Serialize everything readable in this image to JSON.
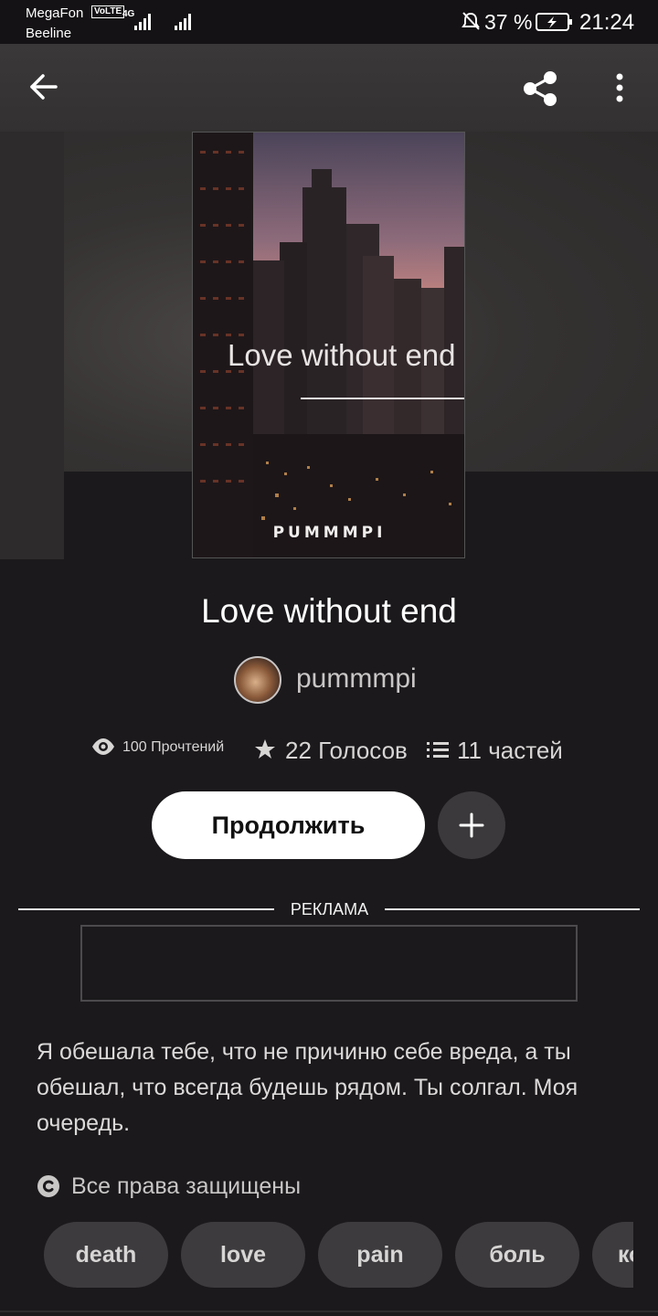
{
  "status_bar": {
    "carrier1": "MegaFon",
    "volte": "VoLTE",
    "network": "4G",
    "carrier2": "Beeline",
    "battery": "37 %",
    "time": "21:24"
  },
  "header": {
    "back_icon": "arrow-left-icon",
    "share_icon": "share-icon",
    "more_icon": "more-vertical-icon"
  },
  "cover": {
    "title": "Love without end",
    "author": "PUMMMPI"
  },
  "story": {
    "title": "Love without end",
    "author": "pummmpi",
    "reads": "100 Прочтений",
    "votes": "22 Голосов",
    "parts": "11 частей",
    "continue_label": "Продолжить",
    "add_icon": "plus-icon"
  },
  "ad": {
    "label": "РЕКЛАМА"
  },
  "description": "Я обешала тебе, что не причиню себе вреда, а ты обешал, что всегда будешь рядом. Ты солгал. Моя очередь.",
  "copyright": "Все права защищены",
  "tags": [
    "death",
    "love",
    "pain",
    "боль",
    "ко"
  ]
}
